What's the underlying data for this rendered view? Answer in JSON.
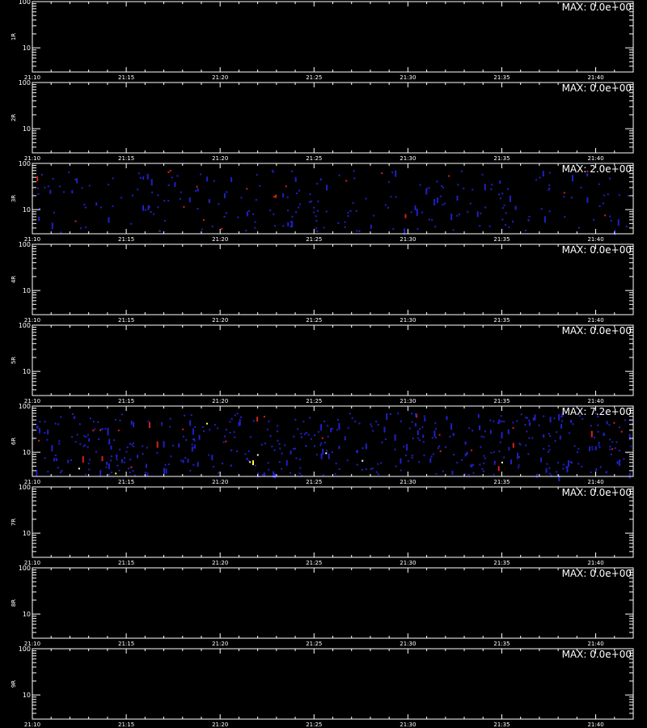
{
  "chart_data": {
    "type": "heatmap",
    "x_tick_labels": [
      "21:10",
      "21:15",
      "21:20",
      "21:25",
      "21:30",
      "21:35",
      "21:40"
    ],
    "x_tick_minutes": [
      10,
      15,
      20,
      25,
      30,
      35,
      40
    ],
    "xlim_minutes": [
      10,
      42
    ],
    "y_tick_labels": [
      "100",
      "10"
    ],
    "ylim": [
      3,
      100
    ],
    "y_scale": "log",
    "grid": false,
    "colors": {
      "background": "#000000",
      "frame": "#ffffff",
      "low": "#2020c8",
      "mid": "#d82020",
      "high": "#ffff40",
      "white": "#ffffff"
    },
    "panels": [
      {
        "label": "1R",
        "max_text": "MAX: 0.0e+00",
        "max": 0.0
      },
      {
        "label": "2R",
        "max_text": "MAX: 0.0e+00",
        "max": 0.0
      },
      {
        "label": "3R",
        "max_text": "MAX: 2.0e+00",
        "max": 2.0
      },
      {
        "label": "4R",
        "max_text": "MAX: 0.0e+00",
        "max": 0.0
      },
      {
        "label": "5R",
        "max_text": "MAX: 0.0e+00",
        "max": 0.0
      },
      {
        "label": "6R",
        "max_text": "MAX: 7.2e+00",
        "max": 7.2
      },
      {
        "label": "7R",
        "max_text": "MAX: 0.0e+00",
        "max": 0.0
      },
      {
        "label": "8R",
        "max_text": "MAX: 0.0e+00",
        "max": 0.0
      },
      {
        "label": "9R",
        "max_text": "MAX: 0.0e+00",
        "max": 0.0
      }
    ]
  }
}
